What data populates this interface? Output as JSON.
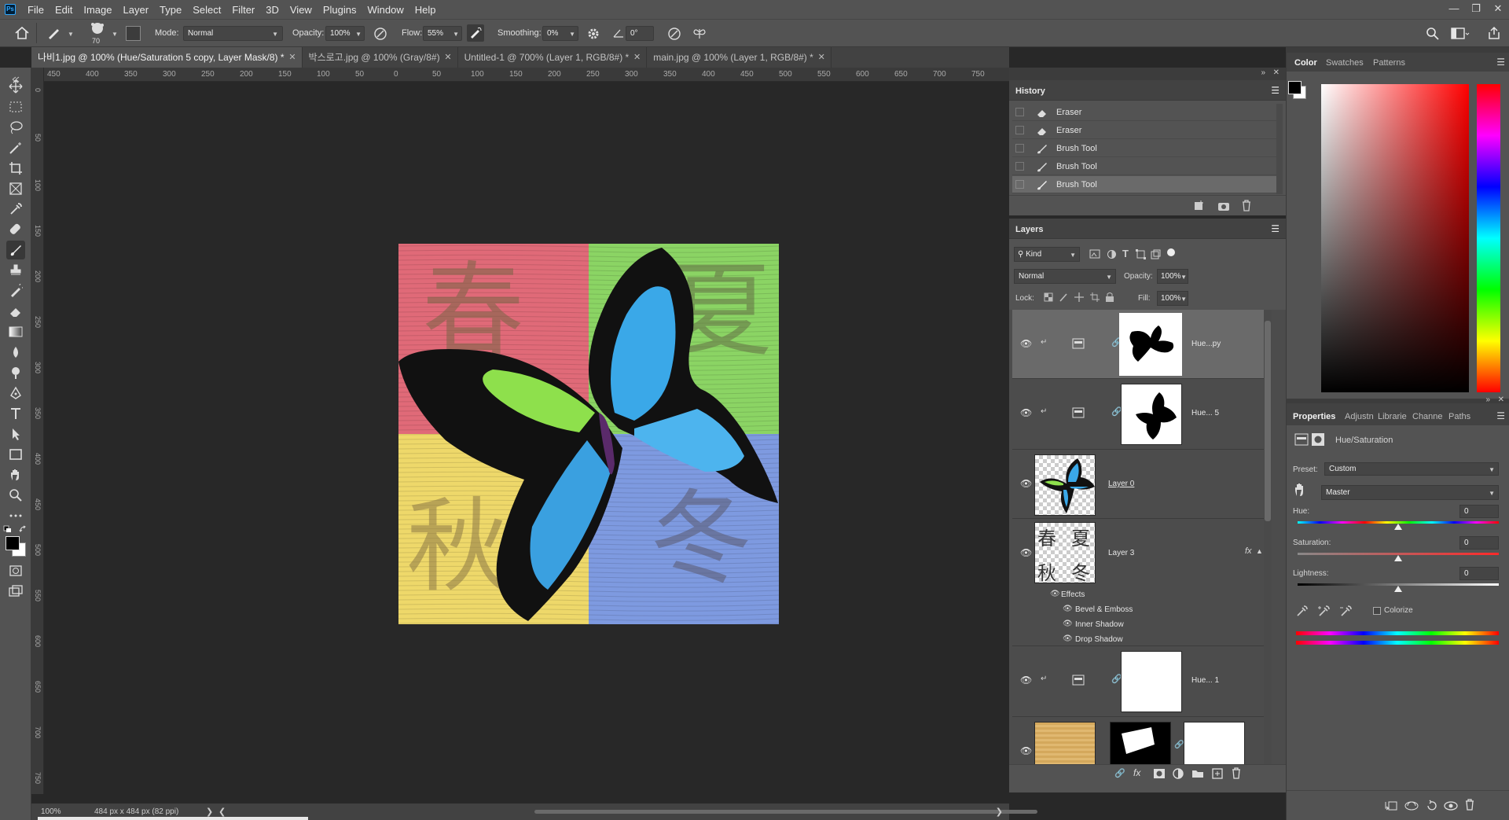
{
  "menu": {
    "items": [
      "File",
      "Edit",
      "Image",
      "Layer",
      "Type",
      "Select",
      "Filter",
      "3D",
      "View",
      "Plugins",
      "Window",
      "Help"
    ]
  },
  "options": {
    "brush_size": "70",
    "mode_label": "Mode:",
    "mode_value": "Normal",
    "opacity_label": "Opacity:",
    "opacity_value": "100%",
    "flow_label": "Flow:",
    "flow_value": "55%",
    "smoothing_label": "Smoothing:",
    "smoothing_value": "0%",
    "angle_value": "0°"
  },
  "tabs": [
    {
      "label": "나비1.jpg @ 100% (Hue/Saturation 5 copy, Layer Mask/8) *"
    },
    {
      "label": "박스로고.jpg @ 100% (Gray/8#)"
    },
    {
      "label": "Untitled-1 @ 700% (Layer 1, RGB/8#) *"
    },
    {
      "label": "main.jpg @ 100% (Layer 1, RGB/8#) *"
    }
  ],
  "ruler_h": [
    "450",
    "400",
    "350",
    "300",
    "250",
    "200",
    "150",
    "100",
    "50",
    "0",
    "50",
    "100",
    "150",
    "200",
    "250",
    "300",
    "350",
    "400",
    "450",
    "500",
    "550",
    "600",
    "650",
    "700",
    "750"
  ],
  "ruler_v": [
    "0",
    "50",
    "100",
    "150",
    "200",
    "250",
    "300",
    "350",
    "400",
    "450",
    "500",
    "550",
    "600",
    "650",
    "700",
    "750"
  ],
  "artwork": {
    "chars": [
      "春",
      "夏",
      "秋",
      "冬"
    ]
  },
  "status": {
    "zoom": "100%",
    "doc_info": "484 px x 484 px (82 ppi)"
  },
  "history": {
    "title": "History",
    "items": [
      "Eraser",
      "Eraser",
      "Brush Tool",
      "Brush Tool",
      "Brush Tool"
    ]
  },
  "layers": {
    "title": "Layers",
    "filter_kind": "Kind",
    "blend_mode": "Normal",
    "opacity_label": "Opacity:",
    "opacity_value": "100%",
    "lock_label": "Lock:",
    "fill_label": "Fill:",
    "fill_value": "100%",
    "rows": [
      {
        "name": "Hue...py"
      },
      {
        "name": "Hue... 5"
      },
      {
        "name": "Layer 0"
      },
      {
        "name": "Layer 3"
      },
      {
        "name": "Hue... 1"
      }
    ],
    "effects_label": "Effects",
    "effects": [
      "Bevel & Emboss",
      "Inner Shadow",
      "Drop Shadow"
    ],
    "fx": "fx"
  },
  "color_panel": {
    "tabs": [
      "Color",
      "Swatches",
      "Patterns"
    ]
  },
  "properties": {
    "tabs": [
      "Properties",
      "Adjustn",
      "Librarie",
      "Channe",
      "Paths"
    ],
    "adjustment_name": "Hue/Saturation",
    "preset_label": "Preset:",
    "preset_value": "Custom",
    "channel_value": "Master",
    "hue_label": "Hue:",
    "hue_value": "0",
    "saturation_label": "Saturation:",
    "saturation_value": "0",
    "lightness_label": "Lightness:",
    "lightness_value": "0",
    "colorize_label": "Colorize"
  }
}
